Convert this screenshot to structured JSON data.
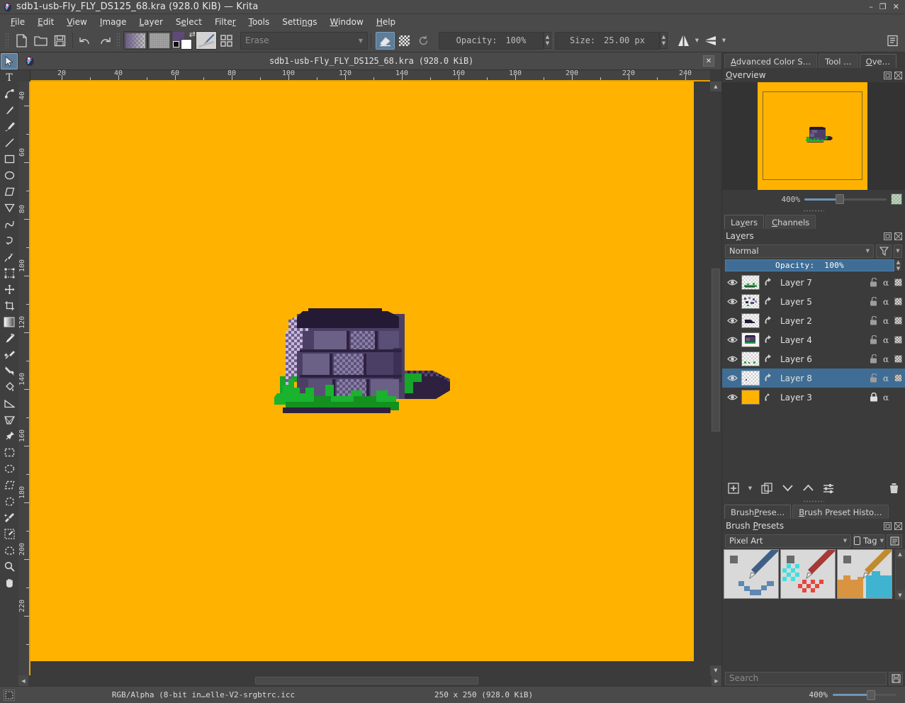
{
  "window": {
    "title": "sdb1-usb-Fly_FLY_DS125_68.kra (928.0 KiB)  — Krita",
    "app_icon": "krita-logo-icon",
    "minimize": "–",
    "maximize": "❐",
    "close": "✕"
  },
  "menubar": {
    "items": [
      {
        "label": "File",
        "accel": "F"
      },
      {
        "label": "Edit",
        "accel": "E"
      },
      {
        "label": "View",
        "accel": "V"
      },
      {
        "label": "Image",
        "accel": "I"
      },
      {
        "label": "Layer",
        "accel": "L"
      },
      {
        "label": "Select",
        "accel": "S"
      },
      {
        "label": "Filter",
        "accel": "r"
      },
      {
        "label": "Tools",
        "accel": "T"
      },
      {
        "label": "Settings",
        "accel": "n"
      },
      {
        "label": "Window",
        "accel": "W"
      },
      {
        "label": "Help",
        "accel": "H"
      }
    ]
  },
  "toolbar": {
    "new_label": "New",
    "open_label": "Open",
    "save_label": "Save",
    "undo_label": "Undo",
    "redo_label": "Redo",
    "gradient_label": "Gradients",
    "pattern_label": "Patterns",
    "fgbg_label": "Foreground / Background color",
    "fg_color": "#5d4a78",
    "bg_color": "#ffffff",
    "brush_preset_label": "Brush preset",
    "workspace_label": "Choose workspace",
    "preset_search_placeholder": "Erase",
    "eraser_label": "Eraser mode",
    "alpha_lock_label": "Preserve alpha",
    "reset_label": "Reset rotation",
    "opacity_label": "Opacity:",
    "opacity_value": "100%",
    "size_label": "Size:",
    "size_value": "25.00 px",
    "mirror_h_label": "Horizontal mirror",
    "mirror_v_label": "Vertical mirror",
    "show_editor_label": "Edit brush settings"
  },
  "toolbox": {
    "tools_top": [
      {
        "name": "select-shapes-tool",
        "icon": "cursor-arrow-icon",
        "selected": true
      },
      {
        "name": "text-tool",
        "icon": "text-icon",
        "selected": false
      },
      {
        "name": "edit-shapes-tool",
        "icon": "node-edit-icon",
        "selected": false
      },
      {
        "name": "calligraphy-tool",
        "icon": "calligraphy-icon",
        "selected": false
      },
      {
        "name": "freehand-brush-tool",
        "icon": "paintbrush-icon",
        "selected": false
      },
      {
        "name": "line-tool",
        "icon": "line-icon",
        "selected": false
      },
      {
        "name": "rectangle-tool",
        "icon": "rectangle-icon",
        "selected": false
      },
      {
        "name": "ellipse-tool",
        "icon": "ellipse-icon",
        "selected": false
      },
      {
        "name": "polygon-tool",
        "icon": "polygon-icon",
        "selected": false
      },
      {
        "name": "polyline-tool",
        "icon": "polyline-icon",
        "selected": false
      },
      {
        "name": "bezier-curve-tool",
        "icon": "bezier-icon",
        "selected": false
      },
      {
        "name": "freehand-path-tool",
        "icon": "freehand-path-icon",
        "selected": false
      },
      {
        "name": "dynamic-brush-tool",
        "icon": "dynamic-brush-icon",
        "selected": false
      },
      {
        "name": "transform-tool",
        "icon": "transform-icon",
        "selected": false
      },
      {
        "name": "move-tool",
        "icon": "move-icon",
        "selected": false
      },
      {
        "name": "crop-tool",
        "icon": "crop-icon",
        "selected": false
      },
      {
        "name": "gradient-tool",
        "icon": "gradient-icon",
        "selected": false
      },
      {
        "name": "color-picker-tool",
        "icon": "eyedropper-icon",
        "selected": false
      },
      {
        "name": "smart-patch-tool",
        "icon": "smart-patch-icon",
        "selected": false
      },
      {
        "name": "colorize-mask-tool",
        "icon": "colorize-icon",
        "selected": false
      },
      {
        "name": "fill-tool",
        "icon": "paint-bucket-icon",
        "selected": false
      },
      {
        "name": "measure-tool",
        "icon": "ruler-icon",
        "selected": false
      },
      {
        "name": "perspective-grid-tool",
        "icon": "perspective-icon",
        "selected": false
      },
      {
        "name": "assistant-tool",
        "icon": "pin-icon",
        "selected": false
      },
      {
        "name": "rectangular-select-tool",
        "icon": "rect-select-icon",
        "selected": false
      },
      {
        "name": "elliptical-select-tool",
        "icon": "ellipse-select-icon",
        "selected": false
      },
      {
        "name": "polygonal-select-tool",
        "icon": "polygon-select-icon",
        "selected": false
      },
      {
        "name": "freehand-select-tool",
        "icon": "lasso-select-icon",
        "selected": false
      },
      {
        "name": "contiguous-select-tool",
        "icon": "magic-wand-icon",
        "selected": false
      },
      {
        "name": "similar-color-select-tool",
        "icon": "similar-select-icon",
        "selected": false
      },
      {
        "name": "bezier-select-tool",
        "icon": "bezier-select-icon",
        "selected": false
      },
      {
        "name": "zoom-tool",
        "icon": "magnifier-icon",
        "selected": false
      },
      {
        "name": "pan-tool",
        "icon": "hand-icon",
        "selected": false
      }
    ]
  },
  "document_tab": {
    "title": "sdb1-usb-Fly_FLY_DS125_68.kra (928.0 KiB)",
    "close_label": "✕",
    "icon": "krita-document-icon"
  },
  "canvas": {
    "background_color": "#FFB300",
    "h_ruler_ticks": [
      "20",
      "40",
      "60",
      "80",
      "100",
      "120",
      "140",
      "160",
      "180",
      "200",
      "220",
      "240"
    ],
    "v_ruler_ticks": [
      "40",
      "60",
      "80",
      "100",
      "120",
      "140",
      "160",
      "180",
      "200",
      "220"
    ],
    "artwork_description": "pixel-art stone well with grass"
  },
  "dock": {
    "top_tabs": [
      {
        "label": "Advanced Color S…",
        "accel": "A",
        "active": false
      },
      {
        "label": "Tool …",
        "accel": "",
        "active": false
      },
      {
        "label": "Ove…",
        "accel": "O",
        "active": true
      }
    ],
    "overview": {
      "title": "Overview",
      "title_accel": "O",
      "float_label": "float",
      "close_label": "close",
      "zoom_value": "400%"
    },
    "layers_tabs": [
      {
        "label": "Layers",
        "accel": "y",
        "active": true
      },
      {
        "label": "Channels",
        "accel": "C",
        "active": false
      }
    ],
    "layers_panel": {
      "title": "Layers",
      "title_accel": "y",
      "blend_mode": "Normal",
      "filter_label": "filter",
      "opacity_label": "Opacity:",
      "opacity_value": "100%",
      "rows": [
        {
          "name": "Layer 7",
          "selected": false,
          "locked": false,
          "visible": true,
          "thumb": "grass-streak"
        },
        {
          "name": "Layer 5",
          "selected": false,
          "locked": false,
          "visible": true,
          "thumb": "speckle-purple"
        },
        {
          "name": "Layer 2",
          "selected": false,
          "locked": false,
          "visible": true,
          "thumb": "dark-blob"
        },
        {
          "name": "Layer 4",
          "selected": false,
          "locked": false,
          "visible": true,
          "thumb": "purple-well"
        },
        {
          "name": "Layer 6",
          "selected": false,
          "locked": false,
          "visible": true,
          "thumb": "faint-green"
        },
        {
          "name": "Layer 8",
          "selected": true,
          "locked": false,
          "visible": true,
          "thumb": "almost-empty"
        },
        {
          "name": "Layer 3",
          "selected": false,
          "locked": true,
          "visible": true,
          "thumb": "orange-fill"
        }
      ],
      "tools": [
        {
          "name": "add-layer-button",
          "icon": "plus-box-icon"
        },
        {
          "name": "add-layer-dropdown",
          "icon": "chevron-down-icon"
        },
        {
          "name": "duplicate-layer-button",
          "icon": "duplicate-icon"
        },
        {
          "name": "move-layer-down-button",
          "icon": "chevron-down-icon"
        },
        {
          "name": "move-layer-up-button",
          "icon": "chevron-up-icon"
        },
        {
          "name": "layer-properties-button",
          "icon": "sliders-icon"
        },
        {
          "name": "delete-layer-button",
          "icon": "trash-icon"
        }
      ]
    },
    "brush_tabs": [
      {
        "label": "Brush Prese…",
        "accel": "P",
        "active": true
      },
      {
        "label": "Brush Preset Histo…",
        "accel": "B",
        "active": false
      }
    ],
    "brush_panel": {
      "title": "Brush Presets",
      "title_accel": "P",
      "tag_filter": "Pixel Art",
      "tag_button_label": "Tag",
      "presets": [
        {
          "name": "pixel-art-blue-preset"
        },
        {
          "name": "pixel-art-red-preset"
        },
        {
          "name": "pixel-art-orange-preset"
        }
      ],
      "search_placeholder": "Search",
      "save_label": "save"
    }
  },
  "statusbar": {
    "selection_icon": "selection-mask-icon",
    "color_space": "RGB/Alpha (8-bit in…elle-V2-srgbtrc.icc",
    "dimensions": "250 x 250 (928.0 KiB)",
    "zoom_value": "400%",
    "zoom_preview_label": "zoom-preview"
  }
}
